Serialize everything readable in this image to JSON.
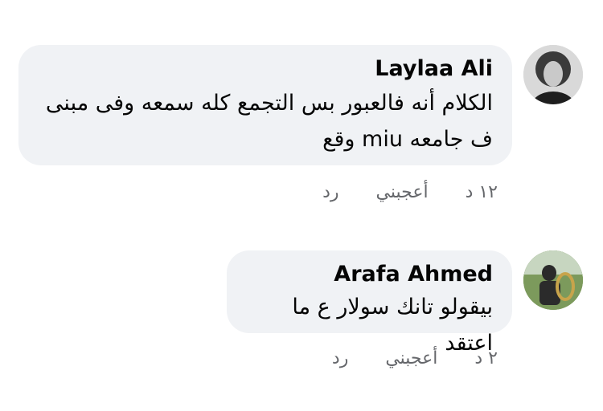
{
  "comments": [
    {
      "author": "Laylaa Ali",
      "text": "الكلام أنه فالعبور بس التجمع كله سمعه وفى مبنى ف جامعه miu وقع",
      "time": "١٢ د",
      "like_label": "أعجبني",
      "reply_label": "رد"
    },
    {
      "author": "Arafa Ahmed",
      "text": "بيقولو تانك سولار ع ما اعتقد",
      "time": "٢ د",
      "like_label": "أعجبني",
      "reply_label": "رد"
    }
  ],
  "colors": {
    "bubble": "#f0f2f5",
    "text": "#050505",
    "meta": "#65676b"
  }
}
